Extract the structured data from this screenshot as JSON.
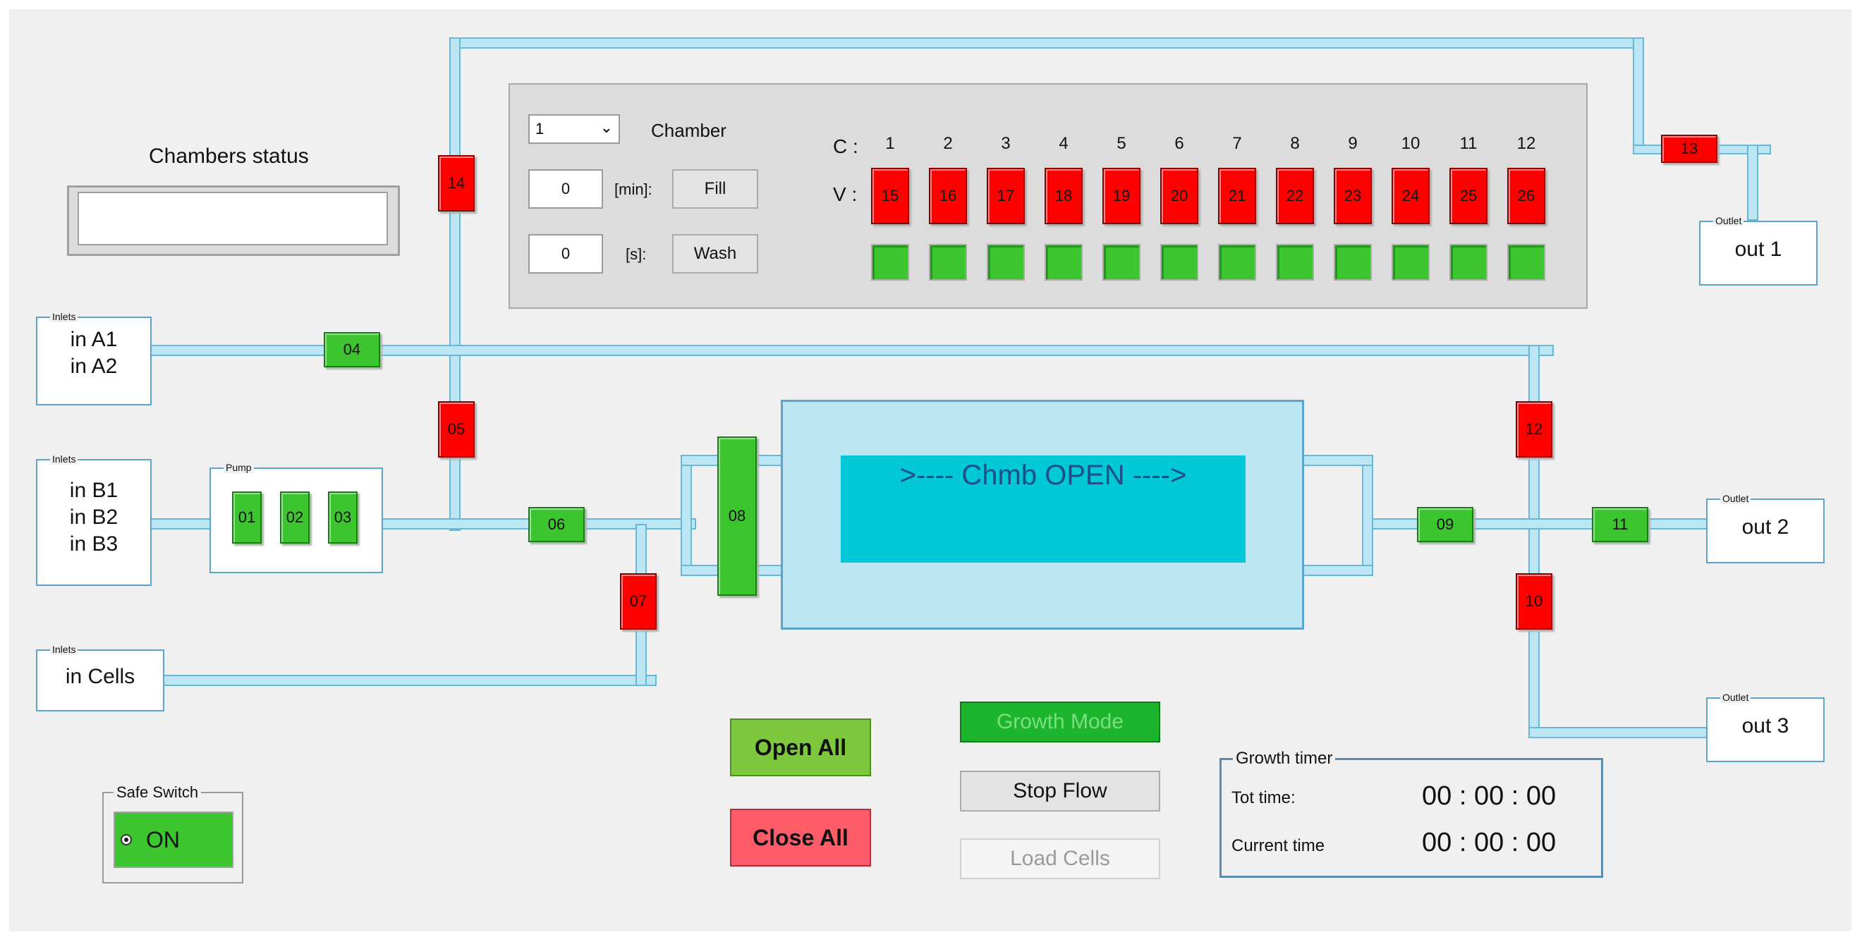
{
  "chambers_status": {
    "title": "Chambers status",
    "value": ""
  },
  "chamber_ctrl": {
    "select_value": "1",
    "chamber_label": "Chamber",
    "min_value": "0",
    "min_label": "[min]:",
    "fill_label": "Fill",
    "s_value": "0",
    "s_label": "[s]:",
    "wash_label": "Wash",
    "c_label": "C :",
    "v_label": "V :",
    "chambers": [
      "1",
      "2",
      "3",
      "4",
      "5",
      "6",
      "7",
      "8",
      "9",
      "10",
      "11",
      "12"
    ],
    "valves": [
      "15",
      "16",
      "17",
      "18",
      "19",
      "20",
      "21",
      "22",
      "23",
      "24",
      "25",
      "26"
    ]
  },
  "inlets": {
    "a": {
      "caption": "Inlets",
      "line1": "in A1",
      "line2": "in A2"
    },
    "b": {
      "caption": "Inlets",
      "line1": "in B1",
      "line2": "in B2",
      "line3": "in B3"
    },
    "cells": {
      "caption": "Inlets",
      "line1": "in Cells"
    }
  },
  "pump": {
    "caption": "Pump",
    "valves": [
      "01",
      "02",
      "03"
    ]
  },
  "outlets": [
    {
      "caption": "Outlet",
      "label": "out 1"
    },
    {
      "caption": "Outlet",
      "label": "out 2"
    },
    {
      "caption": "Outlet",
      "label": "out 3"
    }
  ],
  "valves": {
    "v04": "04",
    "v05": "05",
    "v06": "06",
    "v07": "07",
    "v08": "08",
    "v09": "09",
    "v10": "10",
    "v11": "11",
    "v12": "12",
    "v13": "13",
    "v14": "14"
  },
  "chamber_display": ">---- Chmb OPEN ---->",
  "buttons": {
    "open_all": "Open All",
    "close_all": "Close All",
    "growth_mode": "Growth Mode",
    "stop_flow": "Stop Flow",
    "load_cells": "Load Cells"
  },
  "safe_switch": {
    "caption": "Safe Switch",
    "state": "ON"
  },
  "growth_timer": {
    "caption": "Growth timer",
    "tot_label": "Tot time:",
    "tot_value": "00 : 00 : 00",
    "current_label": "Current time",
    "current_value": "00 : 00 : 00"
  },
  "colors": {
    "valve_closed": "#ff0000",
    "valve_open": "#3cc52e",
    "tube": "#bde6f5",
    "display": "#00c8d6"
  }
}
